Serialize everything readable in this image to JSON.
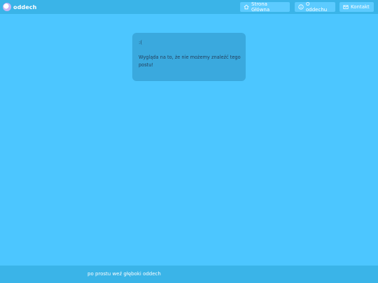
{
  "header": {
    "brand": "oddech",
    "nav": [
      {
        "label": "Strona Główna",
        "icon": "home-icon"
      },
      {
        "label": "O oddechu",
        "icon": "info-icon"
      },
      {
        "label": "Kontakt",
        "icon": "mail-icon"
      }
    ]
  },
  "main": {
    "face": ":(",
    "message": "Wygląda na to, że nie możemy znaleźć tego postu!"
  },
  "footer": {
    "tagline": "po prostu weź głęboki oddech"
  },
  "colors": {
    "background": "#4cc6ff",
    "bar": "#3ab4e8",
    "card": "#3aa9de",
    "nav_button": "#5ccbff"
  }
}
